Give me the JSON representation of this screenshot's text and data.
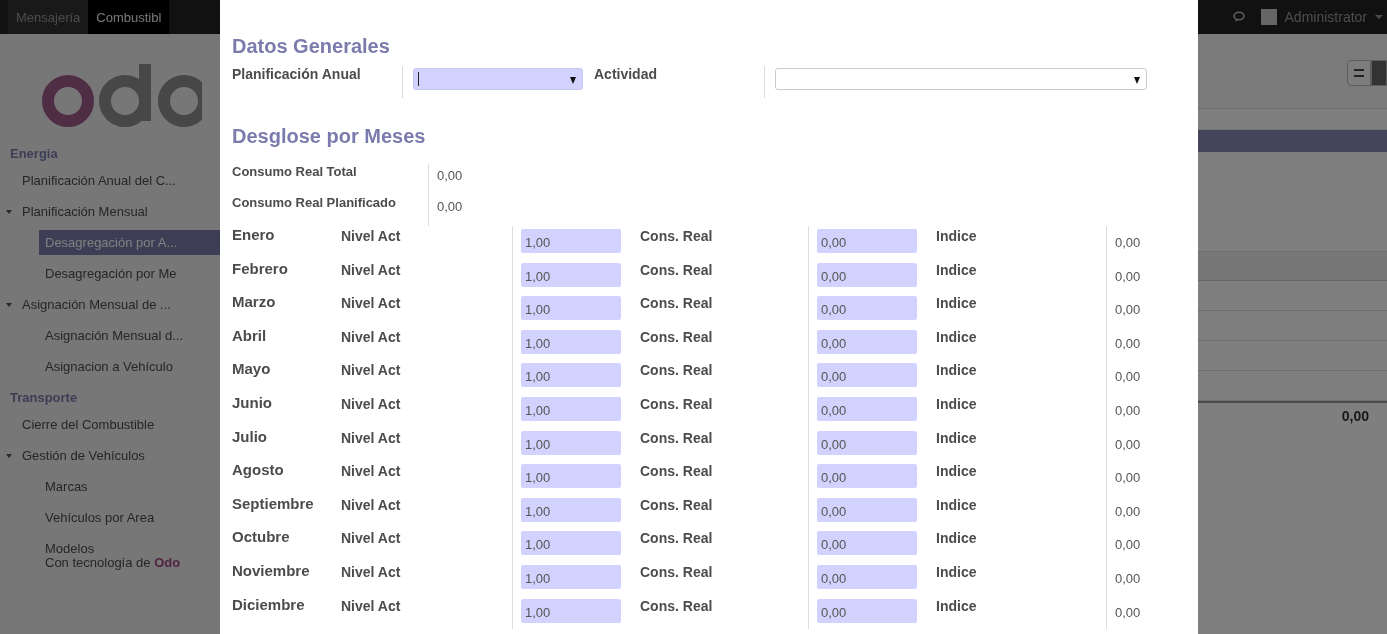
{
  "top_bar": {
    "menu": [
      {
        "label": "Mensajería",
        "selected": false
      },
      {
        "label": "Combustibl",
        "selected": true
      }
    ],
    "user": "Administrator"
  },
  "sidebar": {
    "sections": [
      {
        "title": "Energia",
        "items": [
          {
            "label": "Planificación Anual del C...",
            "selected": false
          },
          {
            "label": "Planificación Mensual",
            "selected": false,
            "expanded": true,
            "children": [
              {
                "label": "Desagregación por A...",
                "selected": true
              },
              {
                "label": "Desagregación por Me",
                "selected": false
              }
            ]
          },
          {
            "label": "Asignación Mensual de ...",
            "selected": false,
            "expanded": true,
            "children": [
              {
                "label": "Asignación Mensual d...",
                "selected": false
              },
              {
                "label": "Asignacion a Vehículo",
                "selected": false
              }
            ]
          }
        ]
      },
      {
        "title": "Transporte",
        "items": [
          {
            "label": "Cierre del Combustible",
            "selected": false
          },
          {
            "label": "Gestión de Vehículos",
            "selected": false,
            "expanded": true,
            "children": [
              {
                "label": "Marcas",
                "selected": false
              },
              {
                "label": "Vehículos por Area",
                "selected": false
              },
              {
                "label": "Modelos",
                "selected": false
              }
            ]
          }
        ]
      }
    ],
    "footer": "Con tecnología de **Odo**"
  },
  "list_view": {
    "total": "0,00"
  },
  "dialog": {
    "general": {
      "title": "Datos Generales",
      "fields": [
        {
          "label": "Planificación Anual",
          "focused": true
        },
        {
          "label": "Actividad",
          "focused": false
        }
      ]
    },
    "breakdown": {
      "title": "Desglose por Meses",
      "totals": [
        {
          "label": "Consumo Real Total",
          "value": "0,00"
        },
        {
          "label": "Consumo Real Planificado",
          "value": "0,00"
        }
      ],
      "months": [
        {
          "month": "Enero",
          "level_label": "Nivel Act",
          "level_value": "1,00",
          "real_label": "Cons. Real",
          "real_value": "0,00",
          "index_label": "Indice",
          "index_value": "0,00"
        },
        {
          "month": "Febrero",
          "level_label": "Nivel Act",
          "level_value": "1,00",
          "real_label": "Cons. Real",
          "real_value": "0,00",
          "index_label": "Indice",
          "index_value": "0,00"
        },
        {
          "month": "Marzo",
          "level_label": "Nivel Act",
          "level_value": "1,00",
          "real_label": "Cons. Real",
          "real_value": "0,00",
          "index_label": "Indice",
          "index_value": "0,00"
        },
        {
          "month": "Abril",
          "level_label": "Nivel Act",
          "level_value": "1,00",
          "real_label": "Cons. Real",
          "real_value": "0,00",
          "index_label": "Indice",
          "index_value": "0,00"
        },
        {
          "month": "Mayo",
          "level_label": "Nivel Act",
          "level_value": "1,00",
          "real_label": "Cons. Real",
          "real_value": "0,00",
          "index_label": "Indice",
          "index_value": "0,00"
        },
        {
          "month": "Junio",
          "level_label": "Nivel Act",
          "level_value": "1,00",
          "real_label": "Cons. Real",
          "real_value": "0,00",
          "index_label": "Indice",
          "index_value": "0,00"
        },
        {
          "month": "Julio",
          "level_label": "Nivel Act",
          "level_value": "1,00",
          "real_label": "Cons. Real",
          "real_value": "0,00",
          "index_label": "Indice",
          "index_value": "0,00"
        },
        {
          "month": "Agosto",
          "level_label": "Nivel Act",
          "level_value": "1,00",
          "real_label": "Cons. Real",
          "real_value": "0,00",
          "index_label": "Indice",
          "index_value": "0,00"
        },
        {
          "month": "Septiembre",
          "level_label": "Nivel Act",
          "level_value": "1,00",
          "real_label": "Cons. Real",
          "real_value": "0,00",
          "index_label": "Indice",
          "index_value": "0,00"
        },
        {
          "month": "Octubre",
          "level_label": "Nivel Act",
          "level_value": "1,00",
          "real_label": "Cons. Real",
          "real_value": "0,00",
          "index_label": "Indice",
          "index_value": "0,00"
        },
        {
          "month": "Noviembre",
          "level_label": "Nivel Act",
          "level_value": "1,00",
          "real_label": "Cons. Real",
          "real_value": "0,00",
          "index_label": "Indice",
          "index_value": "0,00"
        },
        {
          "month": "Diciembre",
          "level_label": "Nivel Act",
          "level_value": "1,00",
          "real_label": "Cons. Real",
          "real_value": "0,00",
          "index_label": "Indice",
          "index_value": "0,00"
        }
      ]
    }
  }
}
